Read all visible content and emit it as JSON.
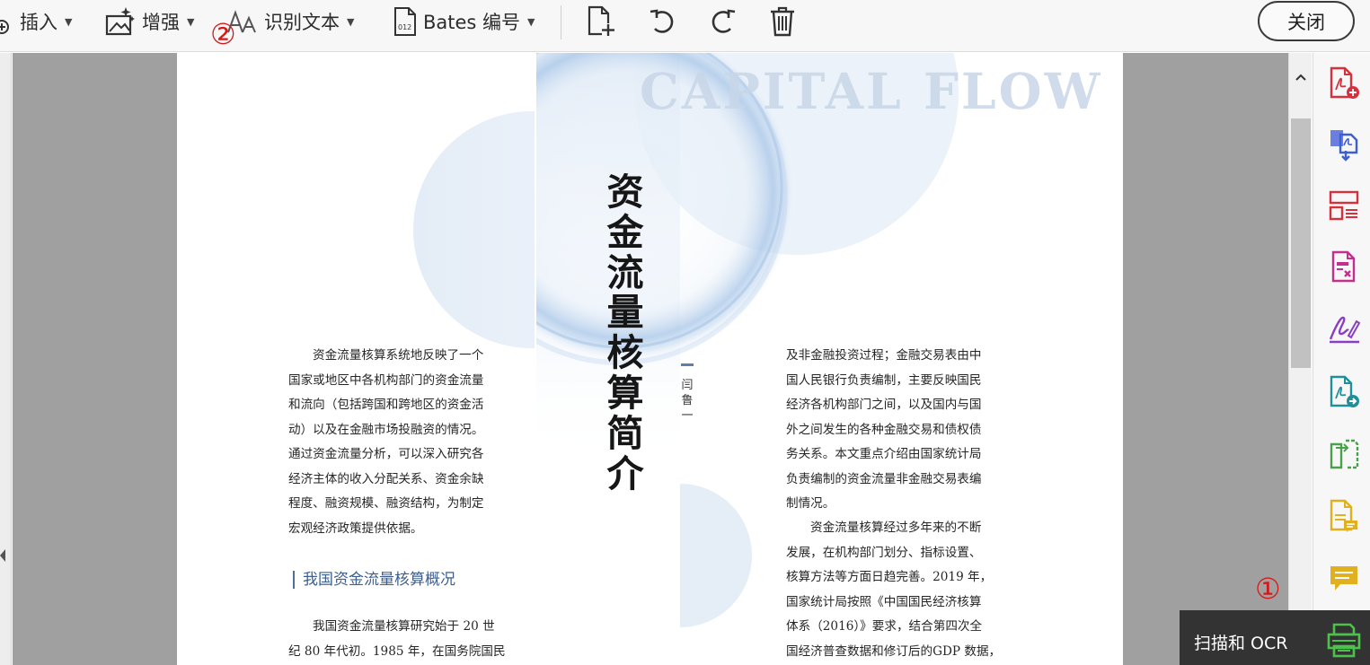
{
  "toolbar": {
    "insert_label": "插入",
    "enhance_label": "增强",
    "ocr_label": "识别文本",
    "bates_label": "Bates 编号",
    "close_label": "关闭",
    "icons": [
      "insert-page-icon",
      "rotate-left-icon",
      "rotate-right-icon",
      "trash-icon"
    ]
  },
  "annotations": {
    "marker_1": "①",
    "marker_2": "②"
  },
  "page": {
    "capital_flow": "CAPITAL FLOW",
    "title_chars": [
      "资",
      "金",
      "流",
      "量",
      "核",
      "算",
      "简",
      "介"
    ],
    "author_chars": [
      "闫",
      "鲁",
      "一"
    ],
    "left_paragraph1": [
      "资金流量核算系统地反映了一个",
      "国家或地区中各机构部门的资金流量",
      "和流向（包括跨国和跨地区的资金活",
      "动）以及在金融市场投融资的情况。",
      "通过资金流量分析，可以深入研究各",
      "经济主体的收入分配关系、资金余缺",
      "程度、融资规模、融资结构，为制定",
      "宏观经济政策提供依据。"
    ],
    "section_heading": "我国资金流量核算概况",
    "left_paragraph2": [
      "我国资金流量核算研究始于 20 世",
      "纪 80 年代初。1985 年，在国务院国民"
    ],
    "right_paragraph1": [
      "及非金融投资过程；金融交易表由中",
      "国人民银行负责编制，主要反映国民",
      "经济各机构部门之间，以及国内与国",
      "外之间发生的各种金融交易和债权债",
      "务关系。本文重点介绍由国家统计局",
      "负责编制的资金流量非金融交易表编",
      "制情况。"
    ],
    "right_paragraph2": [
      "资金流量核算经过多年来的不断",
      "发展，在机构部门划分、指标设置、",
      "核算方法等方面日趋完善。2019 年，",
      "国家统计局按照《中国国民经济核算",
      "体系（2016）》要求，结合第四次全",
      "国经济普查数据和修订后的GDP 数据，"
    ]
  },
  "rightbar": {
    "icons": [
      "create-pdf-icon",
      "combine-files-icon",
      "organize-pages-icon",
      "redact-icon",
      "fill-sign-icon",
      "export-pdf-icon",
      "compare-files-icon",
      "edit-comment-icon",
      "comment-icon"
    ]
  },
  "scan_panel": {
    "label": "扫描和 OCR",
    "icon": "scanner-icon"
  },
  "colors": {
    "accent_red": "#d6303c",
    "accent_blue": "#3d5fcf",
    "accent_purple": "#9b3fc2",
    "accent_teal": "#1f8f9a",
    "accent_green": "#4aa14a",
    "accent_yellow": "#e0b020"
  }
}
